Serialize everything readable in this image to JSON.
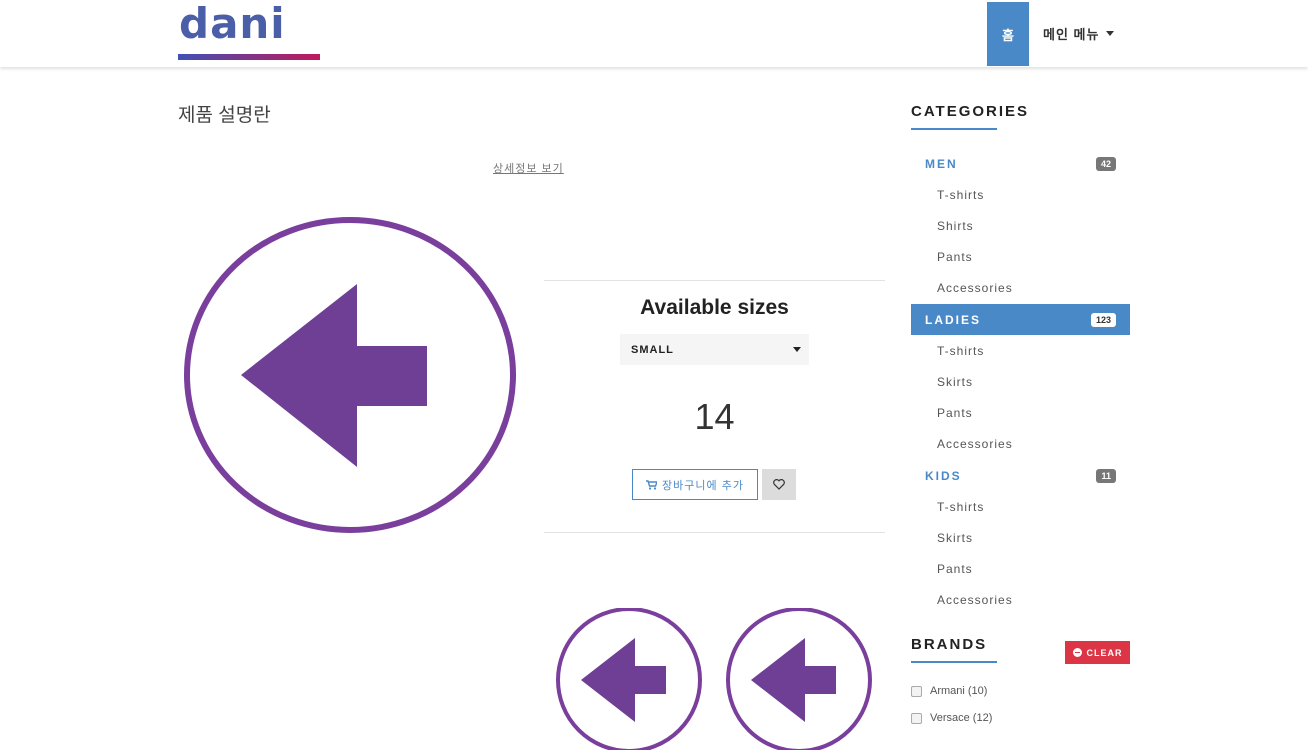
{
  "header": {
    "logo_text": "dani",
    "nav_home": "홈",
    "nav_menu": "메인 메뉴"
  },
  "main": {
    "page_title": "제품 설명란",
    "detail_link": "상세정보 보기",
    "sizes_title": "Available sizes",
    "selected_size": "SMALL",
    "price": "14",
    "add_to_cart": "장바구니에 추가"
  },
  "sidebar": {
    "categories_heading": "CATEGORIES",
    "categories": [
      {
        "label": "MEN",
        "count": "42",
        "items": [
          "T-shirts",
          "Shirts",
          "Pants",
          "Accessories"
        ]
      },
      {
        "label": "LADIES",
        "count": "123",
        "items": [
          "T-shirts",
          "Skirts",
          "Pants",
          "Accessories"
        ]
      },
      {
        "label": "KIDS",
        "count": "11",
        "items": [
          "T-shirts",
          "Skirts",
          "Pants",
          "Accessories"
        ]
      }
    ],
    "brands_heading": "BRANDS",
    "clear_label": "CLEAR",
    "brands": [
      "Armani (10)",
      "Versace (12)"
    ]
  },
  "colors": {
    "accent": "#4a89c8",
    "arrow_purple": "#7a3e9d",
    "danger": "#dc3545"
  }
}
